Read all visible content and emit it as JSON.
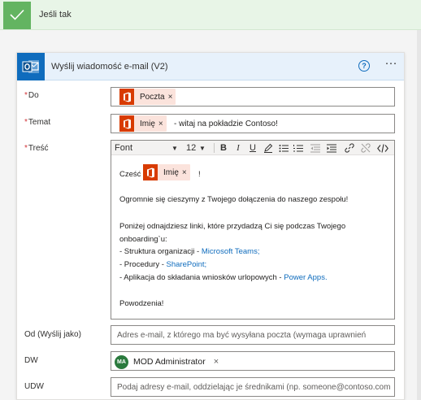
{
  "branch": {
    "label": "Jeśli tak"
  },
  "card": {
    "title": "Wyślij wiadomość e-mail (V2)",
    "help_icon": "?",
    "more_icon": "···"
  },
  "fields": {
    "to": {
      "label": "Do",
      "token": "Poczta",
      "remove": "×"
    },
    "subject": {
      "label": "Temat",
      "token": "Imię",
      "remove": "×",
      "text": "- witaj na pokładzie Contoso!"
    },
    "body": {
      "label": "Treść",
      "toolbar": {
        "font": "Font",
        "size": "12"
      },
      "greeting_prefix": "Cześć",
      "greeting_token": "Imię",
      "greeting_remove": "×",
      "greeting_suffix": "!",
      "line1": "Ogromnie się cieszymy z Twojego dołączenia do naszego zespołu!",
      "line2": "Poniżej odnajdziesz linki, które przydadzą Ci się podczas Twojego",
      "line3": "onboarding`u:",
      "line4_prefix": "- Struktura organizacji - ",
      "line4_link": "Microsoft Teams;",
      "line5_prefix": "- Procedury - ",
      "line5_link": "SharePoint;",
      "line6_prefix": "- Aplikacja do składania wniosków urlopowych - ",
      "line6_link": "Power Apps.",
      "closing": "Powodzenia!"
    },
    "from": {
      "label": "Od (Wyślij jako)",
      "placeholder": "Adres e-mail, z którego ma być wysyłana poczta (wymaga uprawnień"
    },
    "cc": {
      "label": "DW",
      "person_initials": "MA",
      "person_name": "MOD Administrator",
      "remove": "×"
    },
    "bcc": {
      "label": "UDW",
      "placeholder": "Podaj adresy e-mail, oddzielając je średnikami (np. someone@contoso.com"
    }
  },
  "colors": {
    "accent": "#0f6cbd",
    "success": "#63b461",
    "token": "#d83b01",
    "required": "#d13438"
  }
}
